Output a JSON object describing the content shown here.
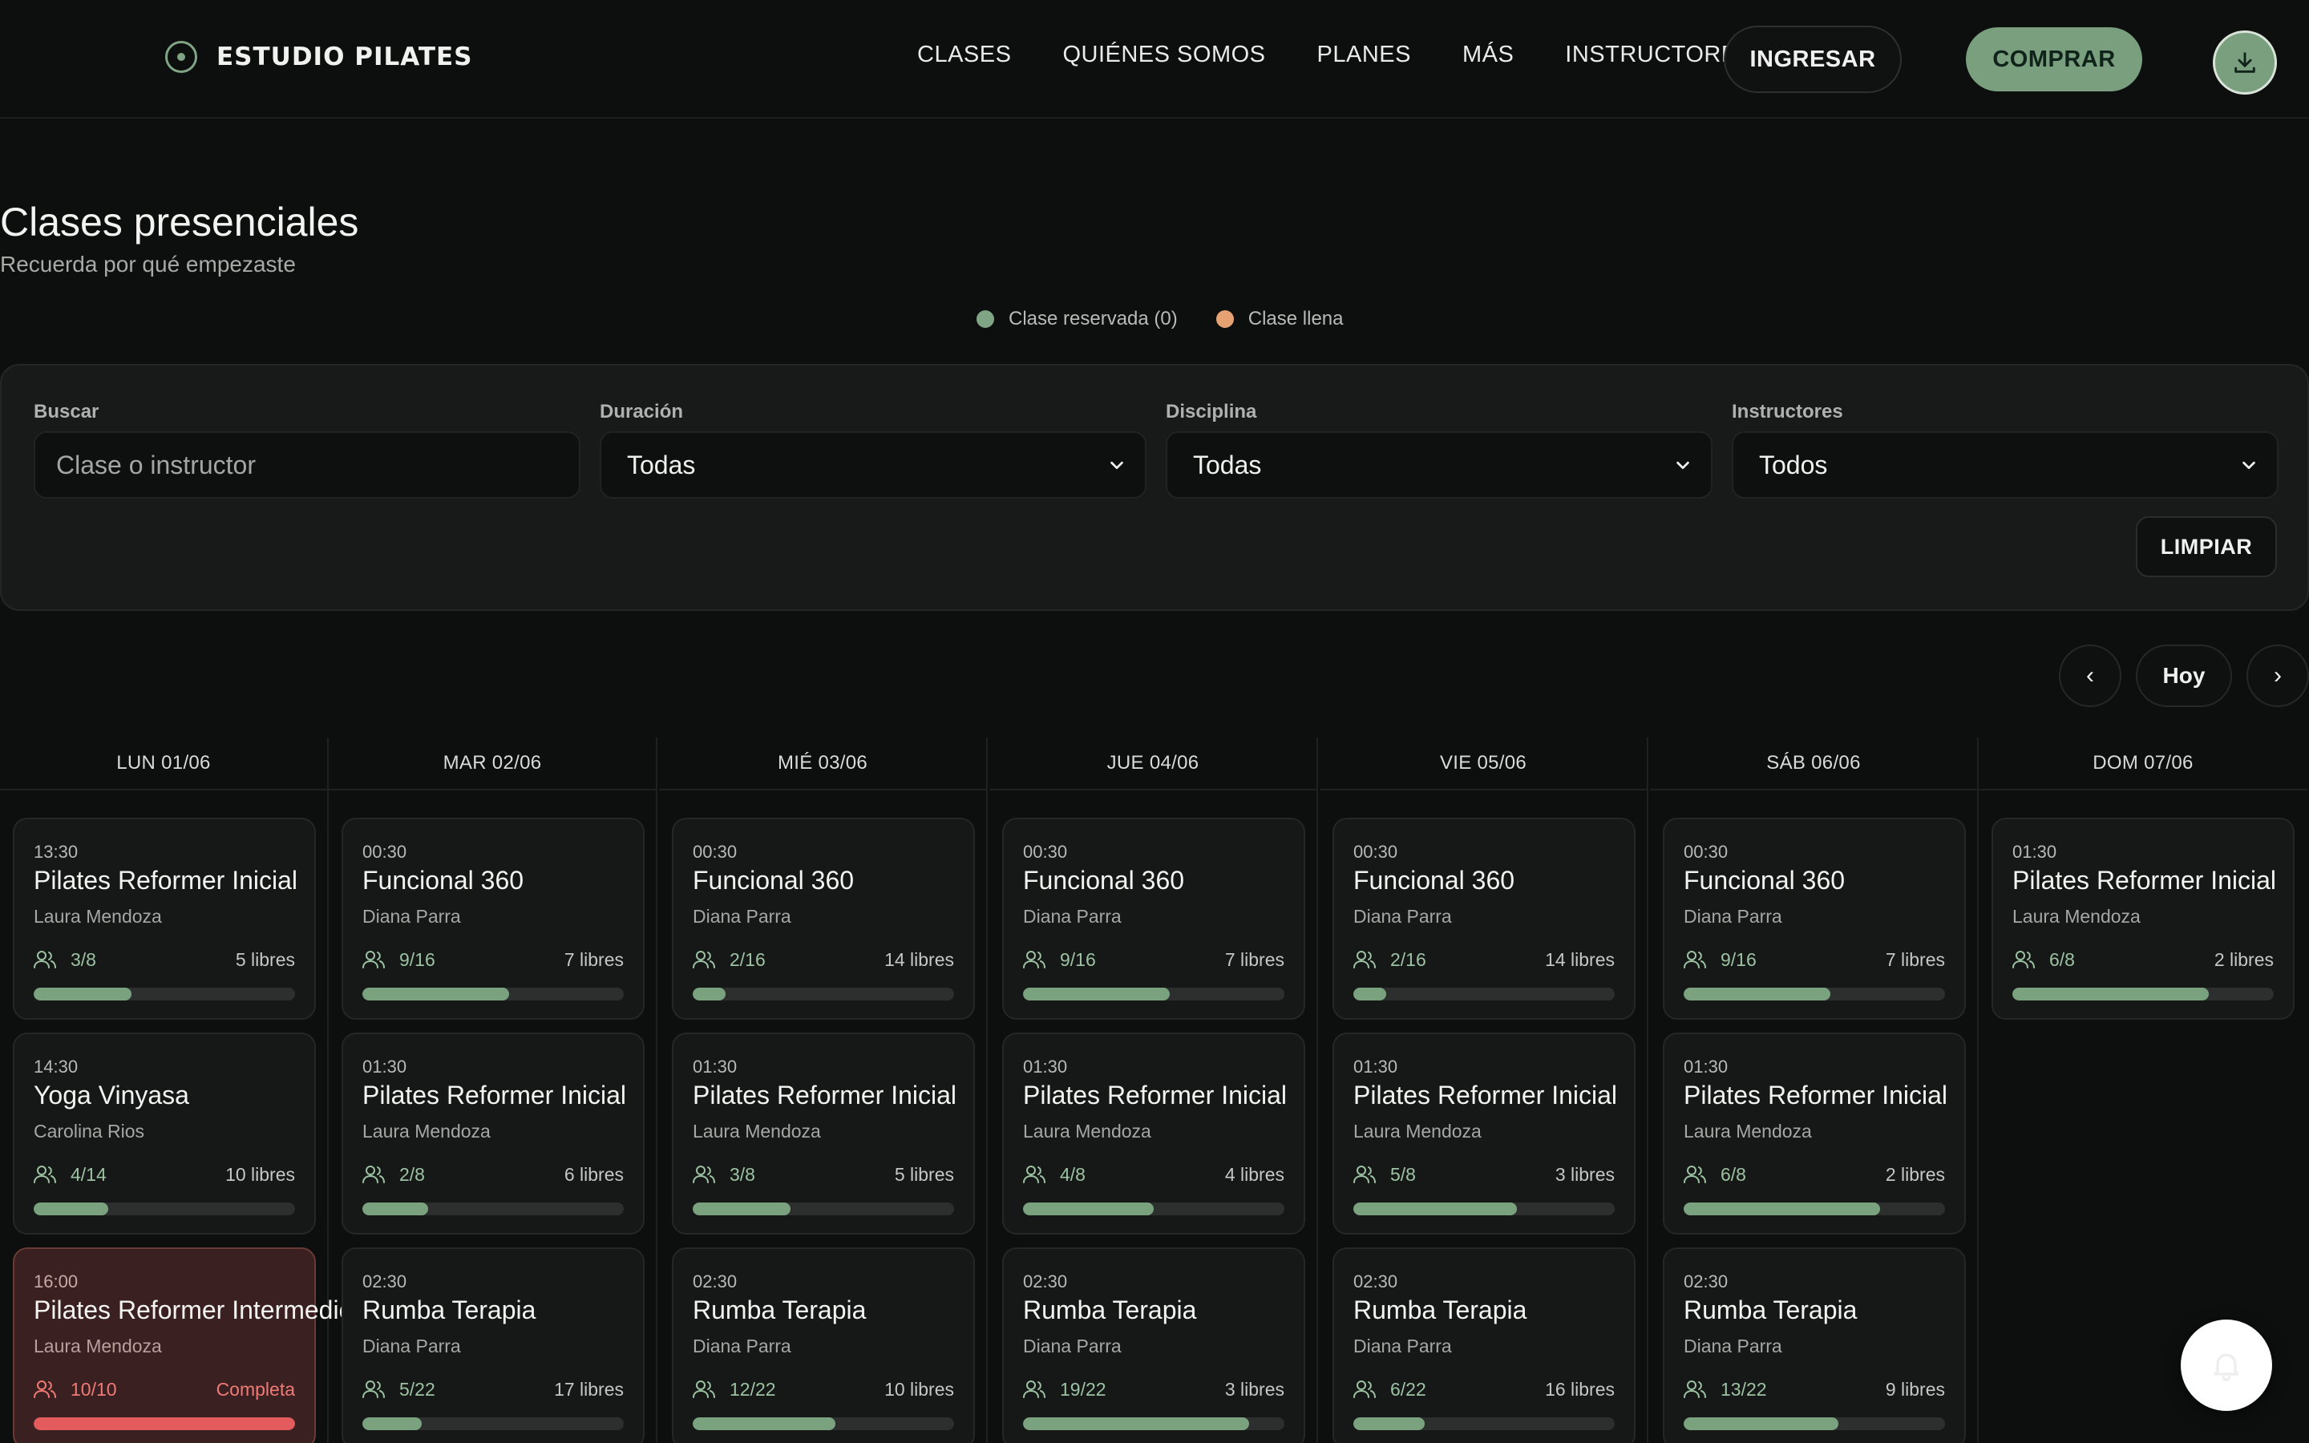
{
  "brand": {
    "name": "ESTUDIO PILATES"
  },
  "nav": {
    "links": [
      "CLASES",
      "QUIÉNES SOMOS",
      "PLANES",
      "MÁS",
      "INSTRUCTORES"
    ],
    "login_label": "INGRESAR",
    "buy_label": "COMPRAR"
  },
  "header": {
    "title": "Clases presenciales",
    "subtitle": "Recuerda por qué empezaste"
  },
  "legend": {
    "reserved_label": "Clase reservada (0)",
    "full_label": "Clase llena",
    "reserved_color": "#7fa585",
    "full_color": "#e6a272"
  },
  "filters": {
    "search": {
      "label": "Buscar",
      "placeholder": "Clase o instructor"
    },
    "duration": {
      "label": "Duración",
      "value": "Todas"
    },
    "discipline": {
      "label": "Disciplina",
      "value": "Todas"
    },
    "instructors": {
      "label": "Instructores",
      "value": "Todos"
    },
    "clear_label": "LIMPIAR"
  },
  "date_nav": {
    "prev": "‹",
    "today": "Hoy",
    "next": "›"
  },
  "days": [
    {
      "label": "LUN 01/06",
      "classes": [
        {
          "time": "13:30",
          "name": "Pilates Reformer Inicial",
          "instructor": "Laura Mendoza",
          "count": "3/8",
          "free": "5 libres",
          "fill": 0.375
        },
        {
          "time": "14:30",
          "name": "Yoga Vinyasa",
          "instructor": "Carolina Rios",
          "count": "4/14",
          "free": "10 libres",
          "fill": 0.286
        },
        {
          "time": "16:00",
          "name": "Pilates Reformer Intermedio",
          "instructor": "Laura Mendoza",
          "count": "10/10",
          "free": "Completa",
          "fill": 1.0,
          "full": true
        }
      ]
    },
    {
      "label": "MAR 02/06",
      "classes": [
        {
          "time": "00:30",
          "name": "Funcional 360",
          "instructor": "Diana Parra",
          "count": "9/16",
          "free": "7 libres",
          "fill": 0.5625
        },
        {
          "time": "01:30",
          "name": "Pilates Reformer Inicial",
          "instructor": "Laura Mendoza",
          "count": "2/8",
          "free": "6 libres",
          "fill": 0.25
        },
        {
          "time": "02:30",
          "name": "Rumba Terapia",
          "instructor": "Diana Parra",
          "count": "5/22",
          "free": "17 libres",
          "fill": 0.227
        }
      ]
    },
    {
      "label": "MIÉ 03/06",
      "classes": [
        {
          "time": "00:30",
          "name": "Funcional 360",
          "instructor": "Diana Parra",
          "count": "2/16",
          "free": "14 libres",
          "fill": 0.125
        },
        {
          "time": "01:30",
          "name": "Pilates Reformer Inicial",
          "instructor": "Laura Mendoza",
          "count": "3/8",
          "free": "5 libres",
          "fill": 0.375
        },
        {
          "time": "02:30",
          "name": "Rumba Terapia",
          "instructor": "Diana Parra",
          "count": "12/22",
          "free": "10 libres",
          "fill": 0.545
        }
      ]
    },
    {
      "label": "JUE 04/06",
      "classes": [
        {
          "time": "00:30",
          "name": "Funcional 360",
          "instructor": "Diana Parra",
          "count": "9/16",
          "free": "7 libres",
          "fill": 0.5625
        },
        {
          "time": "01:30",
          "name": "Pilates Reformer Inicial",
          "instructor": "Laura Mendoza",
          "count": "4/8",
          "free": "4 libres",
          "fill": 0.5
        },
        {
          "time": "02:30",
          "name": "Rumba Terapia",
          "instructor": "Diana Parra",
          "count": "19/22",
          "free": "3 libres",
          "fill": 0.864
        }
      ]
    },
    {
      "label": "VIE 05/06",
      "classes": [
        {
          "time": "00:30",
          "name": "Funcional 360",
          "instructor": "Diana Parra",
          "count": "2/16",
          "free": "14 libres",
          "fill": 0.125
        },
        {
          "time": "01:30",
          "name": "Pilates Reformer Inicial",
          "instructor": "Laura Mendoza",
          "count": "5/8",
          "free": "3 libres",
          "fill": 0.625
        },
        {
          "time": "02:30",
          "name": "Rumba Terapia",
          "instructor": "Diana Parra",
          "count": "6/22",
          "free": "16 libres",
          "fill": 0.273
        }
      ]
    },
    {
      "label": "SÁB 06/06",
      "classes": [
        {
          "time": "00:30",
          "name": "Funcional 360",
          "instructor": "Diana Parra",
          "count": "9/16",
          "free": "7 libres",
          "fill": 0.5625
        },
        {
          "time": "01:30",
          "name": "Pilates Reformer Inicial",
          "instructor": "Laura Mendoza",
          "count": "6/8",
          "free": "2 libres",
          "fill": 0.75
        },
        {
          "time": "02:30",
          "name": "Rumba Terapia",
          "instructor": "Diana Parra",
          "count": "13/22",
          "free": "9 libres",
          "fill": 0.591
        }
      ]
    },
    {
      "label": "DOM 07/06",
      "classes": [
        {
          "time": "01:30",
          "name": "Pilates Reformer Inicial",
          "instructor": "Laura Mendoza",
          "count": "6/8",
          "free": "2 libres",
          "fill": 0.75
        }
      ]
    }
  ],
  "icons": {
    "brand": "target-icon",
    "download": "download-icon",
    "attendees": "users-icon",
    "dropdown": "chevron-down-icon",
    "notifications": "bell-icon"
  },
  "colors": {
    "accent": "#7a9f7f",
    "full_class": "#e45b5d",
    "background": "#0d0e0e"
  }
}
